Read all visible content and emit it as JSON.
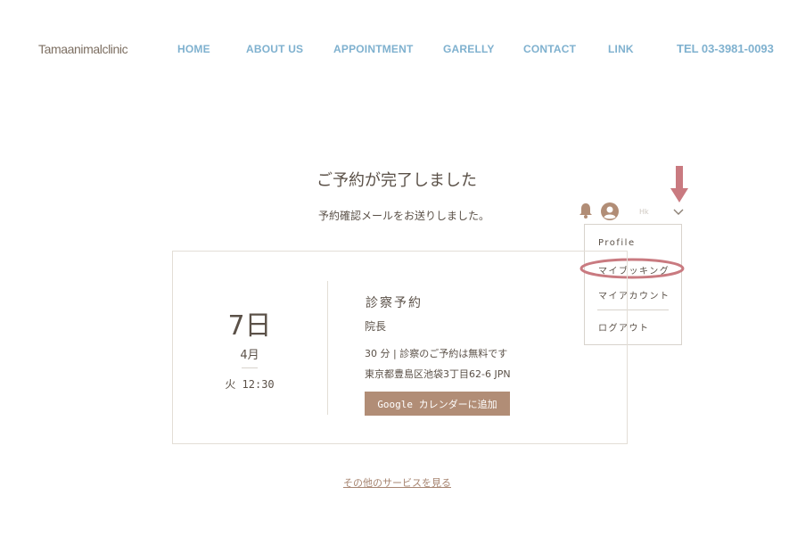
{
  "header": {
    "logo": "Tamaanimalclinic",
    "nav": [
      "HOME",
      "ABOUT US",
      "APPOINTMENT",
      "GARELLY",
      "CONTACT",
      "LINK"
    ],
    "tel": "TEL 03-3981-0093"
  },
  "confirmation": {
    "title": "ご予約が完了しました",
    "subtitle": "予約確認メールをお送りしました。"
  },
  "user_bar": {
    "icons": [
      "bell-icon",
      "avatar-icon",
      "chevron-down-icon"
    ],
    "username": "Hk"
  },
  "dropdown": {
    "items": [
      "Profile",
      "マイブッキング",
      "マイアカウント",
      "ログアウト"
    ]
  },
  "booking": {
    "day": "7日",
    "month": "4月",
    "time": "火 12:30",
    "service_title": "診察予約",
    "staff": "院長",
    "duration": "30 分 | 診察のご予約は無料です",
    "address": "東京都豊島区池袋3丁目62-6 JPN",
    "gcal_button": "Google カレンダーに追加"
  },
  "footer": {
    "more_services": "その他のサービスを見る"
  },
  "colors": {
    "nav": "#7fb1cf",
    "text": "#5b5148",
    "button": "#b18d76",
    "annotation": "#c97a80",
    "link": "#a78571"
  }
}
